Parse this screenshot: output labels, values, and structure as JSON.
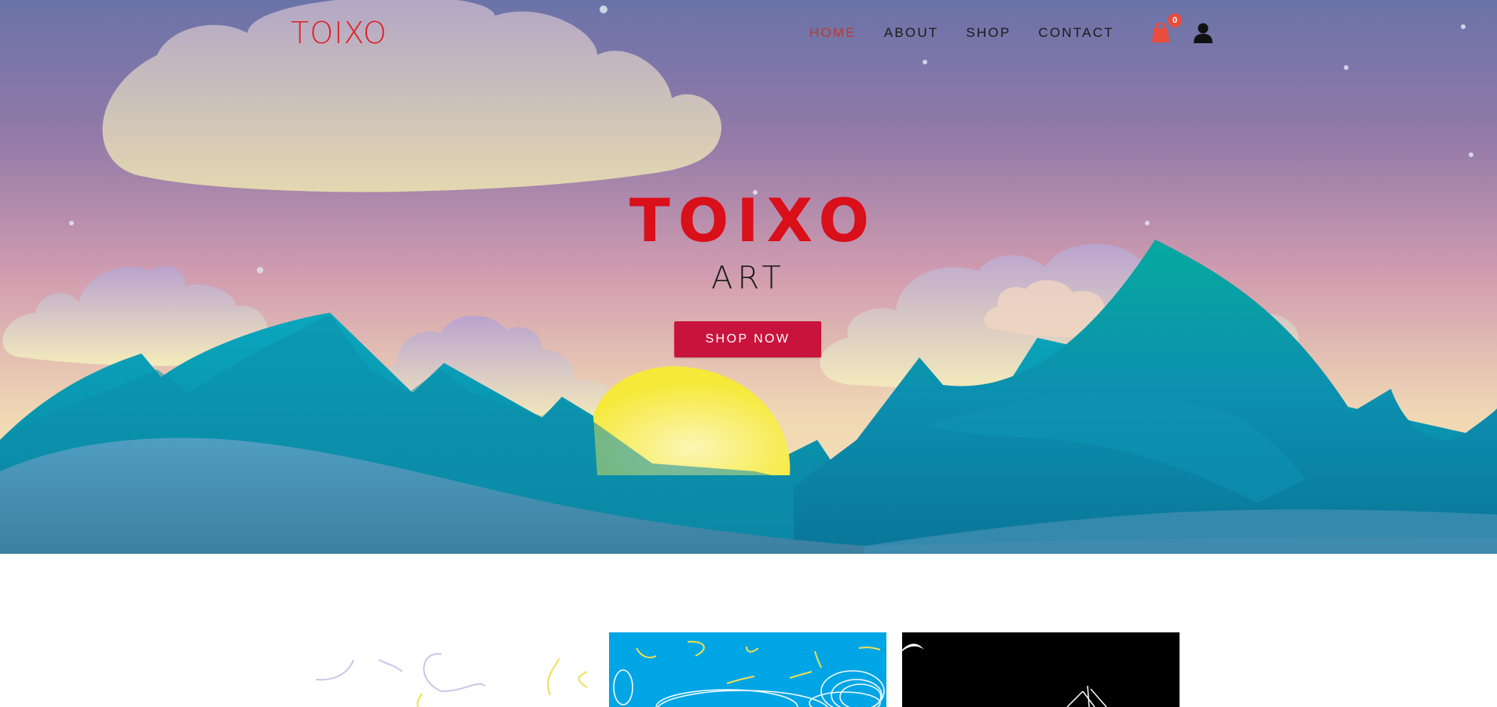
{
  "header": {
    "logo": "TOIXO",
    "nav": [
      {
        "label": "HOME",
        "active": true
      },
      {
        "label": "ABOUT",
        "active": false
      },
      {
        "label": "SHOP",
        "active": false
      },
      {
        "label": "CONTACT",
        "active": false
      }
    ],
    "cart_count": "0",
    "cart_icon": "shopping-bag-icon",
    "user_icon": "user-icon"
  },
  "hero": {
    "title": "TOIXO",
    "subtitle": "ART",
    "cta_label": "SHOP NOW"
  },
  "gallery": {
    "items": [
      {
        "name": "artwork-scribble-white"
      },
      {
        "name": "artwork-scribble-blue"
      },
      {
        "name": "artwork-sketch-black"
      }
    ]
  },
  "colors": {
    "accent": "#c8143c",
    "logo": "#e02020",
    "nav_active": "#c0392b",
    "badge": "#e74c3c",
    "sun": "#f7ea3a",
    "mountain": "#0a98b0"
  }
}
